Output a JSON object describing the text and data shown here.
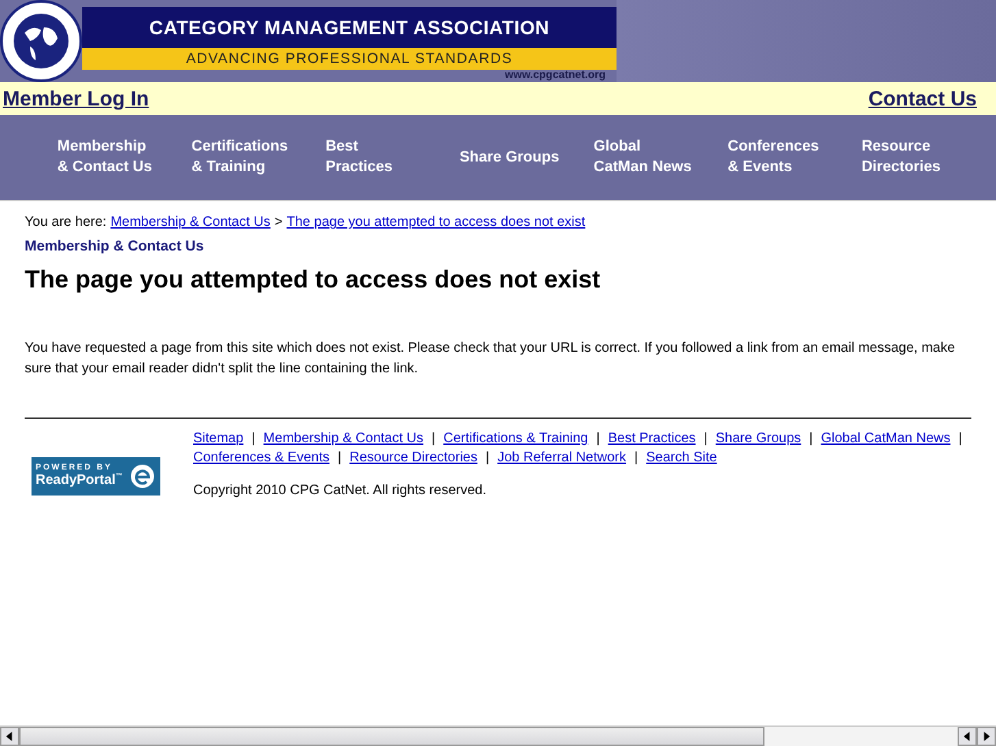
{
  "header": {
    "title": "CATEGORY MANAGEMENT ASSOCIATION",
    "tagline": "ADVANCING PROFESSIONAL STANDARDS",
    "url": "www.cpgcatnet.org"
  },
  "login_bar": {
    "left_link": "Member Log In",
    "right_link": "Contact Us"
  },
  "nav": [
    {
      "label": "Membership & Contact Us"
    },
    {
      "label": "Certifications & Training"
    },
    {
      "label": "Best Practices"
    },
    {
      "label": "Share Groups"
    },
    {
      "label": "Global CatMan News"
    },
    {
      "label": "Conferences & Events"
    },
    {
      "label": "Resource Directories"
    }
  ],
  "breadcrumb": {
    "prefix": "You are here:",
    "items": [
      "Membership & Contact Us",
      "The page you attempted to access does not exist"
    ],
    "separator": ">"
  },
  "section_title": "Membership & Contact Us",
  "heading": "The page you attempted to access does not exist",
  "message": "You have requested a page from this site which does not exist. Please check that your URL is correct. If you followed a link from an email message, make sure that your email reader didn't split the line containing the link.",
  "footer": {
    "badge_top": "POWERED BY",
    "badge_name": "ReadyPortal",
    "badge_mark": "™",
    "links": [
      "Sitemap",
      "Membership & Contact Us",
      "Certifications & Training",
      "Best Practices",
      "Share Groups",
      "Global CatMan News",
      "Conferences & Events",
      "Resource Directories",
      "Job Referral Network",
      "Search Site"
    ],
    "separator": "|",
    "copyright": "Copyright 2010 CPG CatNet. All rights reserved."
  }
}
